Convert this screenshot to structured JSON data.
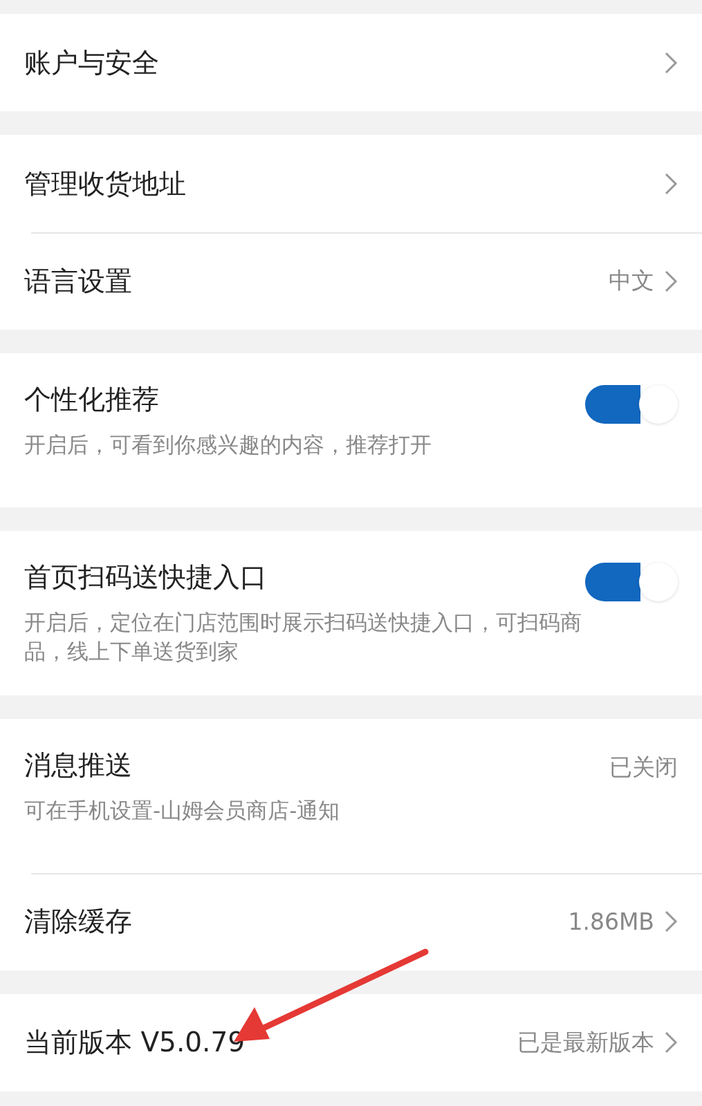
{
  "groups": [
    {
      "rows": [
        {
          "kind": "nav",
          "title": "账户与安全"
        }
      ]
    },
    {
      "rows": [
        {
          "kind": "nav",
          "title": "管理收货地址"
        },
        {
          "kind": "nav",
          "title": "语言设置",
          "value": "中文"
        }
      ]
    },
    {
      "rows": [
        {
          "kind": "toggle",
          "title": "个性化推荐",
          "description": "开启后，可看到你感兴趣的内容，推荐打开",
          "on": true
        }
      ]
    },
    {
      "rows": [
        {
          "kind": "toggle",
          "title": "首页扫码送快捷入口",
          "description": "开启后，定位在门店范围时展示扫码送快捷入口，可扫码商品，线上下单送货到家",
          "on": true
        }
      ]
    },
    {
      "rows": [
        {
          "kind": "info",
          "title": "消息推送",
          "description": "可在手机设置-山姆会员商店-通知",
          "value": "已关闭"
        },
        {
          "kind": "nav",
          "title": "清除缓存",
          "value": "1.86MB"
        }
      ]
    },
    {
      "rows": [
        {
          "kind": "nav",
          "title": "当前版本 V5.0.79",
          "value": "已是最新版本"
        }
      ]
    }
  ]
}
